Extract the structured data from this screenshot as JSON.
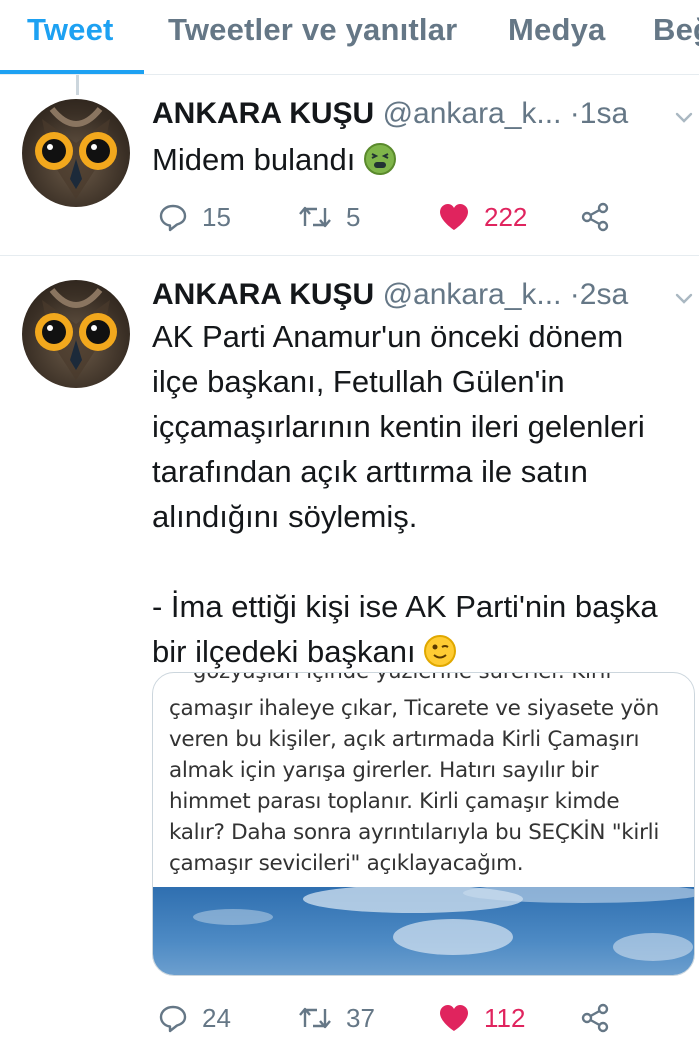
{
  "tabs": [
    {
      "label": "Tweet",
      "active": true
    },
    {
      "label": "Tweetler ve yanıtlar",
      "active": false
    },
    {
      "label": "Medya",
      "active": false
    },
    {
      "label": "Beğ",
      "active": false
    }
  ],
  "tweets": [
    {
      "name": "ANKARA KUŞU",
      "handle": "@ankara_k...",
      "dot": "·",
      "time": "1sa",
      "text_lines": [
        "Midem bulandı"
      ],
      "emoji": "nauseated-face",
      "replies": "15",
      "retweets": "5",
      "likes": "222"
    },
    {
      "name": "ANKARA KUŞU",
      "handle": "@ankara_k...",
      "dot": "·",
      "time": "2sa",
      "text_lines": [
        "AK Parti Anamur'un önceki dönem",
        "ilçe başkanı, Fetullah Gülen'in",
        "iççamaşırlarının kentin ileri gelenleri",
        "tarafından açık arttırma ile satın",
        "alındığını söylemiş.",
        "",
        "- İma ettiği kişi ise AK Parti'nin başka",
        "bir ilçedeki başkanı"
      ],
      "emoji": "winking-face",
      "media": {
        "cut_line": "gözyaşları içinde yüzlerine sürerler. Kirli",
        "lines": [
          "çamaşır ihaleye çıkar, Ticarete ve siyasete yön",
          "veren bu kişiler, açık artırmada Kirli Çamaşırı",
          "almak için yarışa girerler. Hatırı sayılır bir",
          "himmet  parası toplanır. Kirli çamaşır kimde",
          "kalır? Daha sonra ayrıntılarıyla bu SEÇKİN \"kirli",
          "çamaşır sevicileri\" açıklayacağım."
        ]
      },
      "replies": "24",
      "retweets": "37",
      "likes": "112"
    }
  ],
  "colors": {
    "accent": "#1da1f2",
    "like": "#e0245e",
    "muted": "#657786",
    "border": "#e6ecf0"
  },
  "icons": {
    "reply": "reply-icon",
    "retweet": "retweet-icon",
    "like": "heart-icon",
    "share": "share-icon",
    "caret": "chevron-down-icon"
  }
}
